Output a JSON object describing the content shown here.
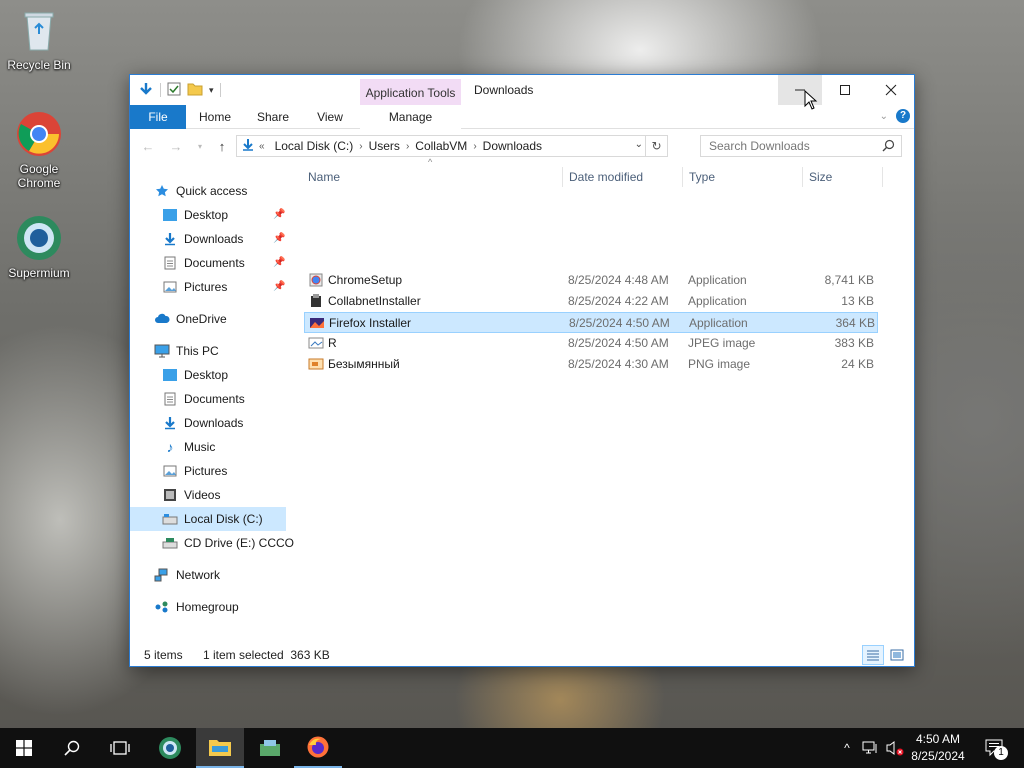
{
  "desktop": {
    "icons": [
      {
        "label": "Recycle Bin"
      },
      {
        "label": "Google Chrome"
      },
      {
        "label": "Supermium"
      }
    ]
  },
  "window": {
    "title": "Downloads",
    "context_tab_group": "Application Tools",
    "ribbon_tabs": {
      "file": "File",
      "home": "Home",
      "share": "Share",
      "view": "View",
      "manage": "Manage"
    },
    "address": {
      "overflow": "«",
      "crumbs": [
        "Local Disk (C:)",
        "Users",
        "CollabVM",
        "Downloads"
      ]
    },
    "search": {
      "placeholder": "Search Downloads"
    }
  },
  "nav": {
    "quick_access": "Quick access",
    "qa_items": [
      "Desktop",
      "Downloads",
      "Documents",
      "Pictures"
    ],
    "onedrive": "OneDrive",
    "this_pc": "This PC",
    "pc_items": [
      "Desktop",
      "Documents",
      "Downloads",
      "Music",
      "Pictures",
      "Videos",
      "Local Disk (C:)",
      "CD Drive (E:) CCCO"
    ],
    "network": "Network",
    "homegroup": "Homegroup"
  },
  "columns": {
    "name": "Name",
    "date": "Date modified",
    "type": "Type",
    "size": "Size"
  },
  "files": [
    {
      "name": "ChromeSetup",
      "date": "8/25/2024 4:48 AM",
      "type": "Application",
      "size": "8,741 KB",
      "icon": "chrome-setup-icon"
    },
    {
      "name": "CollabnetInstaller",
      "date": "8/25/2024 4:22 AM",
      "type": "Application",
      "size": "13 KB",
      "icon": "installer-icon"
    },
    {
      "name": "Firefox Installer",
      "date": "8/25/2024 4:50 AM",
      "type": "Application",
      "size": "364 KB",
      "icon": "firefox-icon",
      "selected": true
    },
    {
      "name": "R",
      "date": "8/25/2024 4:50 AM",
      "type": "JPEG image",
      "size": "383 KB",
      "icon": "jpeg-icon"
    },
    {
      "name": "Безымянный",
      "date": "8/25/2024 4:30 AM",
      "type": "PNG image",
      "size": "24 KB",
      "icon": "png-icon"
    }
  ],
  "status": {
    "items": "5 items",
    "selection": "1 item selected  363 KB"
  },
  "taskbar": {
    "time": "4:50 AM",
    "date": "8/25/2024",
    "notification_count": "1"
  },
  "colors": {
    "accent": "#1979ca",
    "selection": "#cce8ff",
    "context_tab": "#f2dcf5"
  }
}
